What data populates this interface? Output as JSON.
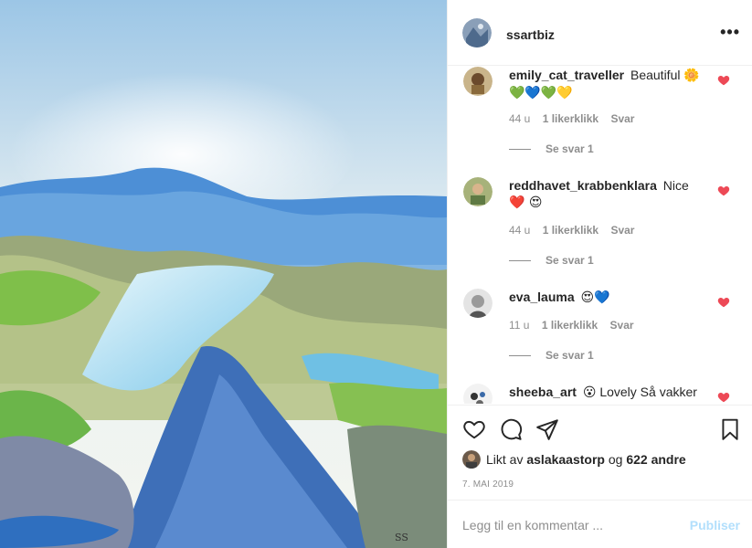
{
  "post": {
    "image_alt": "painting of blue mountain landscape",
    "signature": "SS"
  },
  "header": {
    "username": "ssartbiz",
    "more_label": "•••"
  },
  "comments": [
    {
      "user": "emily_cat_traveller",
      "text": "Beautiful",
      "emoji": "🌼 💚💙💚💛",
      "time": "44 u",
      "likes": "1 likerklikk",
      "reply": "Svar",
      "replies": "Se svar 1"
    },
    {
      "user": "reddhavet_krabbenklara",
      "text": "Nice",
      "emoji": "❤️ 😍",
      "time": "44 u",
      "likes": "1 likerklikk",
      "reply": "Svar",
      "replies": "Se svar 1"
    },
    {
      "user": "eva_lauma",
      "text": "",
      "emoji": "😍💙",
      "time": "11 u",
      "likes": "1 likerklikk",
      "reply": "Svar",
      "replies": "Se svar 1"
    },
    {
      "user": "sheeba_art",
      "text": "Lovely Så vakker",
      "emoji": "😮",
      "time": "",
      "likes": "",
      "reply": "",
      "replies": ""
    }
  ],
  "actions": {
    "liked_prefix": "Likt av",
    "liked_user": "aslakaastorp",
    "liked_mid": "og",
    "liked_count": "622 andre",
    "date": "7. MAI 2019"
  },
  "add_comment": {
    "placeholder": "Legg til en kommentar ...",
    "publish_label": "Publiser"
  },
  "colors": {
    "like_heart": "#ed4956",
    "publish_disabled": "#b2dffc",
    "muted_text": "#8e8e8e"
  }
}
